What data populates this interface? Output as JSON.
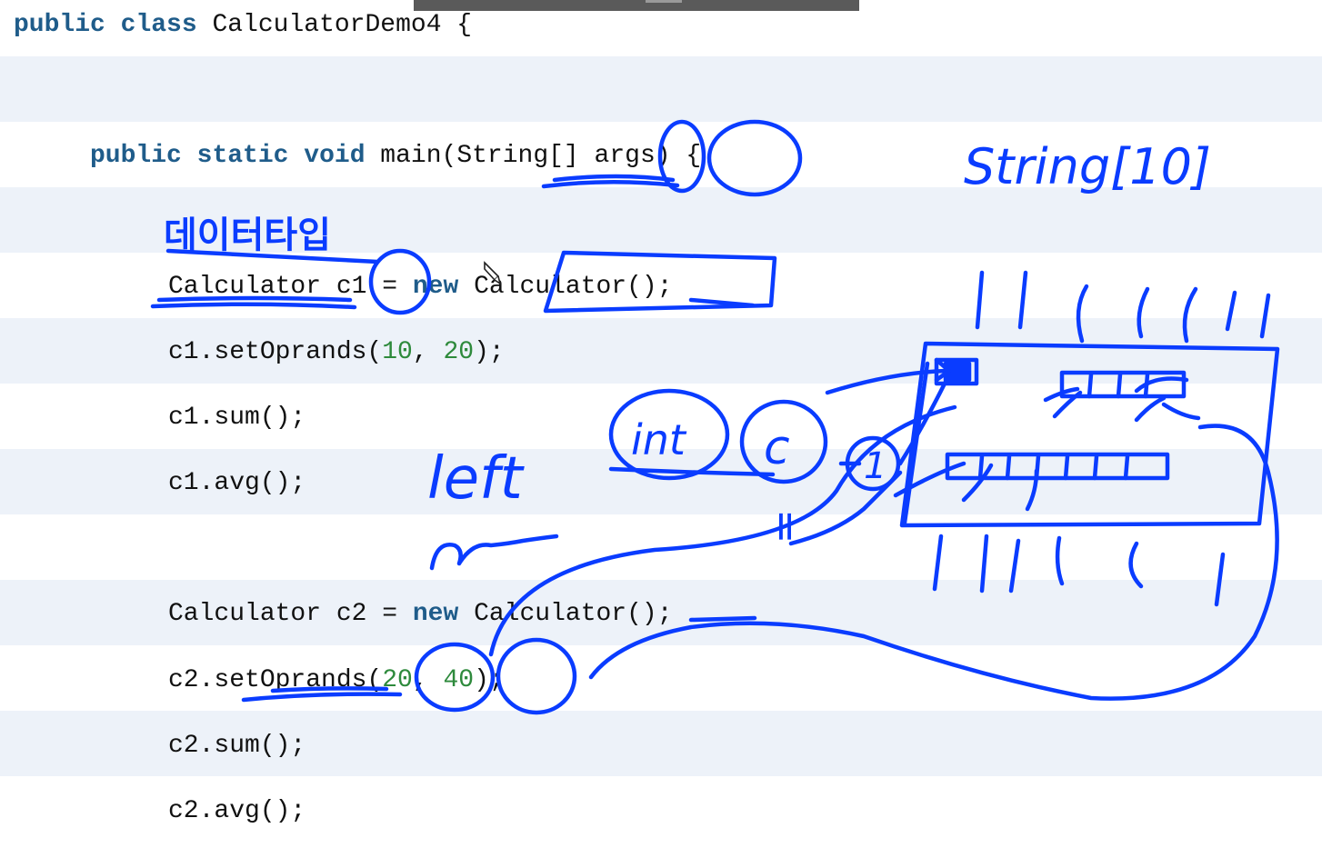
{
  "editor": {
    "lines": {
      "class_kw1": "public",
      "class_kw2": "class",
      "class_rest": " CalculatorDemo4 {",
      "main_kw1": "public",
      "main_kw2": "static",
      "main_kw3": "void",
      "main_rest": " main(String[] args) {",
      "l1_a": "Calculator c1 = ",
      "l1_kw": "new",
      "l1_b": " Calculator();",
      "l2_a": "c1.setOprands(",
      "l2_n1": "10",
      "l2_sep": ", ",
      "l2_n2": "20",
      "l2_b": ");",
      "l3": "c1.sum();",
      "l4": "c1.avg();",
      "l5_a": "Calculator c2 = ",
      "l5_kw": "new",
      "l5_b": " Calculator();",
      "l6_a": "c2.setOprands(",
      "l6_n1": "20",
      "l6_sep": ", ",
      "l6_n2": "40",
      "l6_b": ");",
      "l7": "c2.sum();",
      "l8": "c2.avg();"
    }
  },
  "annotations": {
    "korean_label": "데이터타입",
    "string_label": "String[10]",
    "left_label": "left",
    "int_label": "int",
    "c_label": "c",
    "one_label": "1",
    "eq_label": "="
  },
  "colors": {
    "keyword": "#1f5c8a",
    "number": "#2e8a3c",
    "ink": "#0a3cff",
    "stripe": "#edf2f9"
  }
}
